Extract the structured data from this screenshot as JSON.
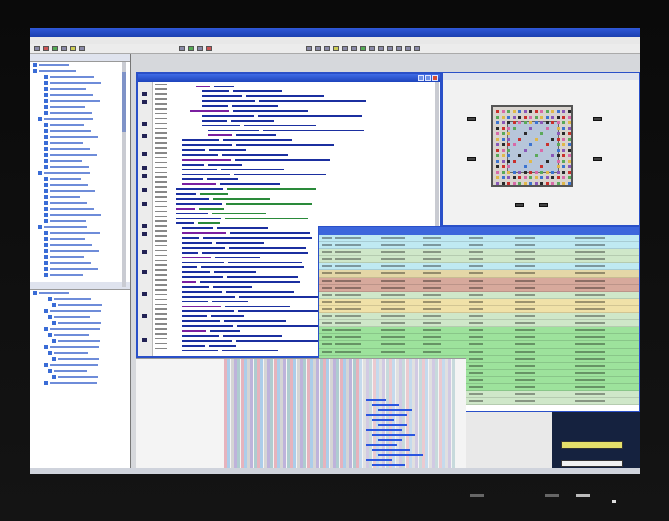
{
  "window": {
    "title": "",
    "menu": [
      "",
      "",
      "",
      "",
      "",
      "",
      "",
      ""
    ]
  },
  "editor": {
    "title": ""
  },
  "top_view": {
    "pane_title": "",
    "caption_line1": "",
    "caption_line2": ""
  },
  "colors": {
    "title_blue": "#2f58d8",
    "row_colors": [
      "#bfe9f2",
      "#bfe9f2",
      "#cfe7c9",
      "#cfe7c9",
      "#bfe9f2",
      "#e4d7a7",
      "#d7a99c",
      "#d7a99c",
      "#cfe7c9",
      "#f0e1a8",
      "#f0e1a8",
      "#cfe7c9",
      "#cfe7c9",
      "#9de29c",
      "#9de29c",
      "#9de29c",
      "#9de29c",
      "#9de29c",
      "#9de29c",
      "#9de29c",
      "#9de29c",
      "#9de29c",
      "#cfe7c9",
      "#cfe7c9"
    ]
  },
  "icons": [
    "folder-icon",
    "file-icon",
    "expand-icon",
    "close-icon",
    "minimize-icon",
    "maximize-icon"
  ]
}
